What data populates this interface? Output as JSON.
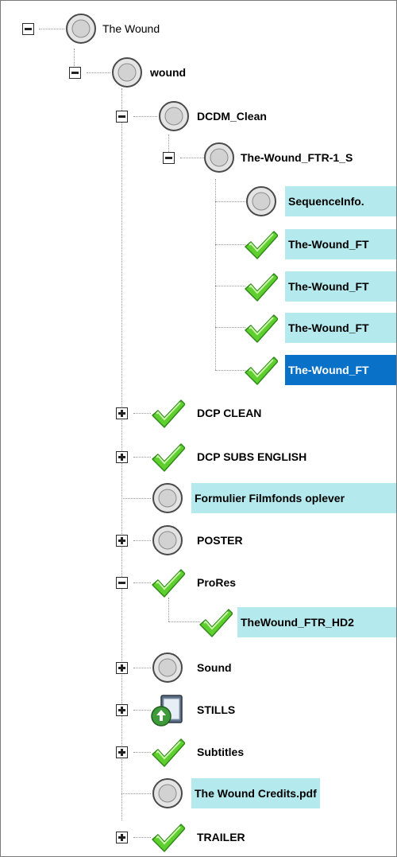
{
  "tree": {
    "root": {
      "label": "The Wound",
      "icon": "status-circle-icon"
    },
    "wound": {
      "label": "wound",
      "icon": "status-circle-icon"
    },
    "dcdm_clean": {
      "label": "DCDM_Clean",
      "icon": "status-circle-icon"
    },
    "ftr_folder": {
      "label": "The-Wound_FTR-1_S",
      "icon": "status-circle-icon"
    },
    "seq_info": {
      "label": "SequenceInfo.",
      "icon": "status-circle-icon"
    },
    "ftr_file_1": {
      "label": "The-Wound_FT",
      "icon": "checkmark-icon"
    },
    "ftr_file_2": {
      "label": "The-Wound_FT",
      "icon": "checkmark-icon"
    },
    "ftr_file_3": {
      "label": "The-Wound_FT",
      "icon": "checkmark-icon"
    },
    "ftr_file_4": {
      "label": "The-Wound_FT",
      "icon": "checkmark-icon"
    },
    "dcp_clean": {
      "label": "DCP CLEAN",
      "icon": "checkmark-icon"
    },
    "dcp_subs": {
      "label": "DCP SUBS ENGLISH",
      "icon": "checkmark-icon"
    },
    "formulier": {
      "label": "Formulier Filmfonds oplever",
      "icon": "status-circle-icon"
    },
    "poster": {
      "label": "POSTER",
      "icon": "status-circle-icon"
    },
    "prores": {
      "label": "ProRes",
      "icon": "checkmark-icon"
    },
    "prores_file": {
      "label": "TheWound_FTR_HD2",
      "icon": "checkmark-icon"
    },
    "sound": {
      "label": "Sound",
      "icon": "status-circle-icon"
    },
    "stills": {
      "label": "STILLS",
      "icon": "upload-folder-icon"
    },
    "subtitles": {
      "label": "Subtitles",
      "icon": "checkmark-icon"
    },
    "credits": {
      "label": "The Wound Credits.pdf",
      "icon": "status-circle-icon"
    },
    "trailer": {
      "label": "TRAILER",
      "icon": "checkmark-icon"
    }
  },
  "colors": {
    "highlight": "#b4e9ed",
    "selected": "#0a71c9",
    "check": "#5fcf2f"
  }
}
